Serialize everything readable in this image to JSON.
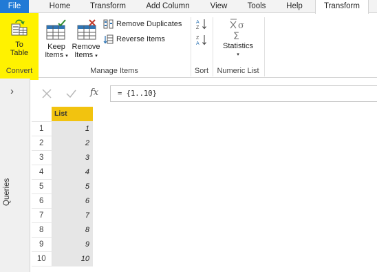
{
  "tabs": [
    "File",
    "Home",
    "Transform",
    "Add Column",
    "View",
    "Tools",
    "Help",
    "Transform"
  ],
  "ribbon": {
    "convert": {
      "button_line1": "To",
      "button_line2": "Table",
      "group_label": "Convert"
    },
    "manage_items": {
      "keep_line1": "Keep",
      "keep_line2": "Items",
      "remove_line1": "Remove",
      "remove_line2": "Items",
      "remove_duplicates": "Remove Duplicates",
      "reverse_items": "Reverse Items",
      "group_label": "Manage Items"
    },
    "sort": {
      "group_label": "Sort"
    },
    "numeric_list": {
      "statistics": "Statistics",
      "group_label": "Numeric List"
    }
  },
  "side_panel": {
    "label": "Queries"
  },
  "formula_bar": {
    "fx": "fx",
    "formula": "= {1..10}"
  },
  "grid": {
    "column_header": "List",
    "rows": [
      "1",
      "2",
      "3",
      "4",
      "5",
      "6",
      "7",
      "8",
      "9",
      "10"
    ],
    "values": [
      "1",
      "2",
      "3",
      "4",
      "5",
      "6",
      "7",
      "8",
      "9",
      "10"
    ]
  },
  "colors": {
    "file_tab": "#217ad6",
    "convert_highlight": "#fff200",
    "column_header": "#f2c30f"
  }
}
